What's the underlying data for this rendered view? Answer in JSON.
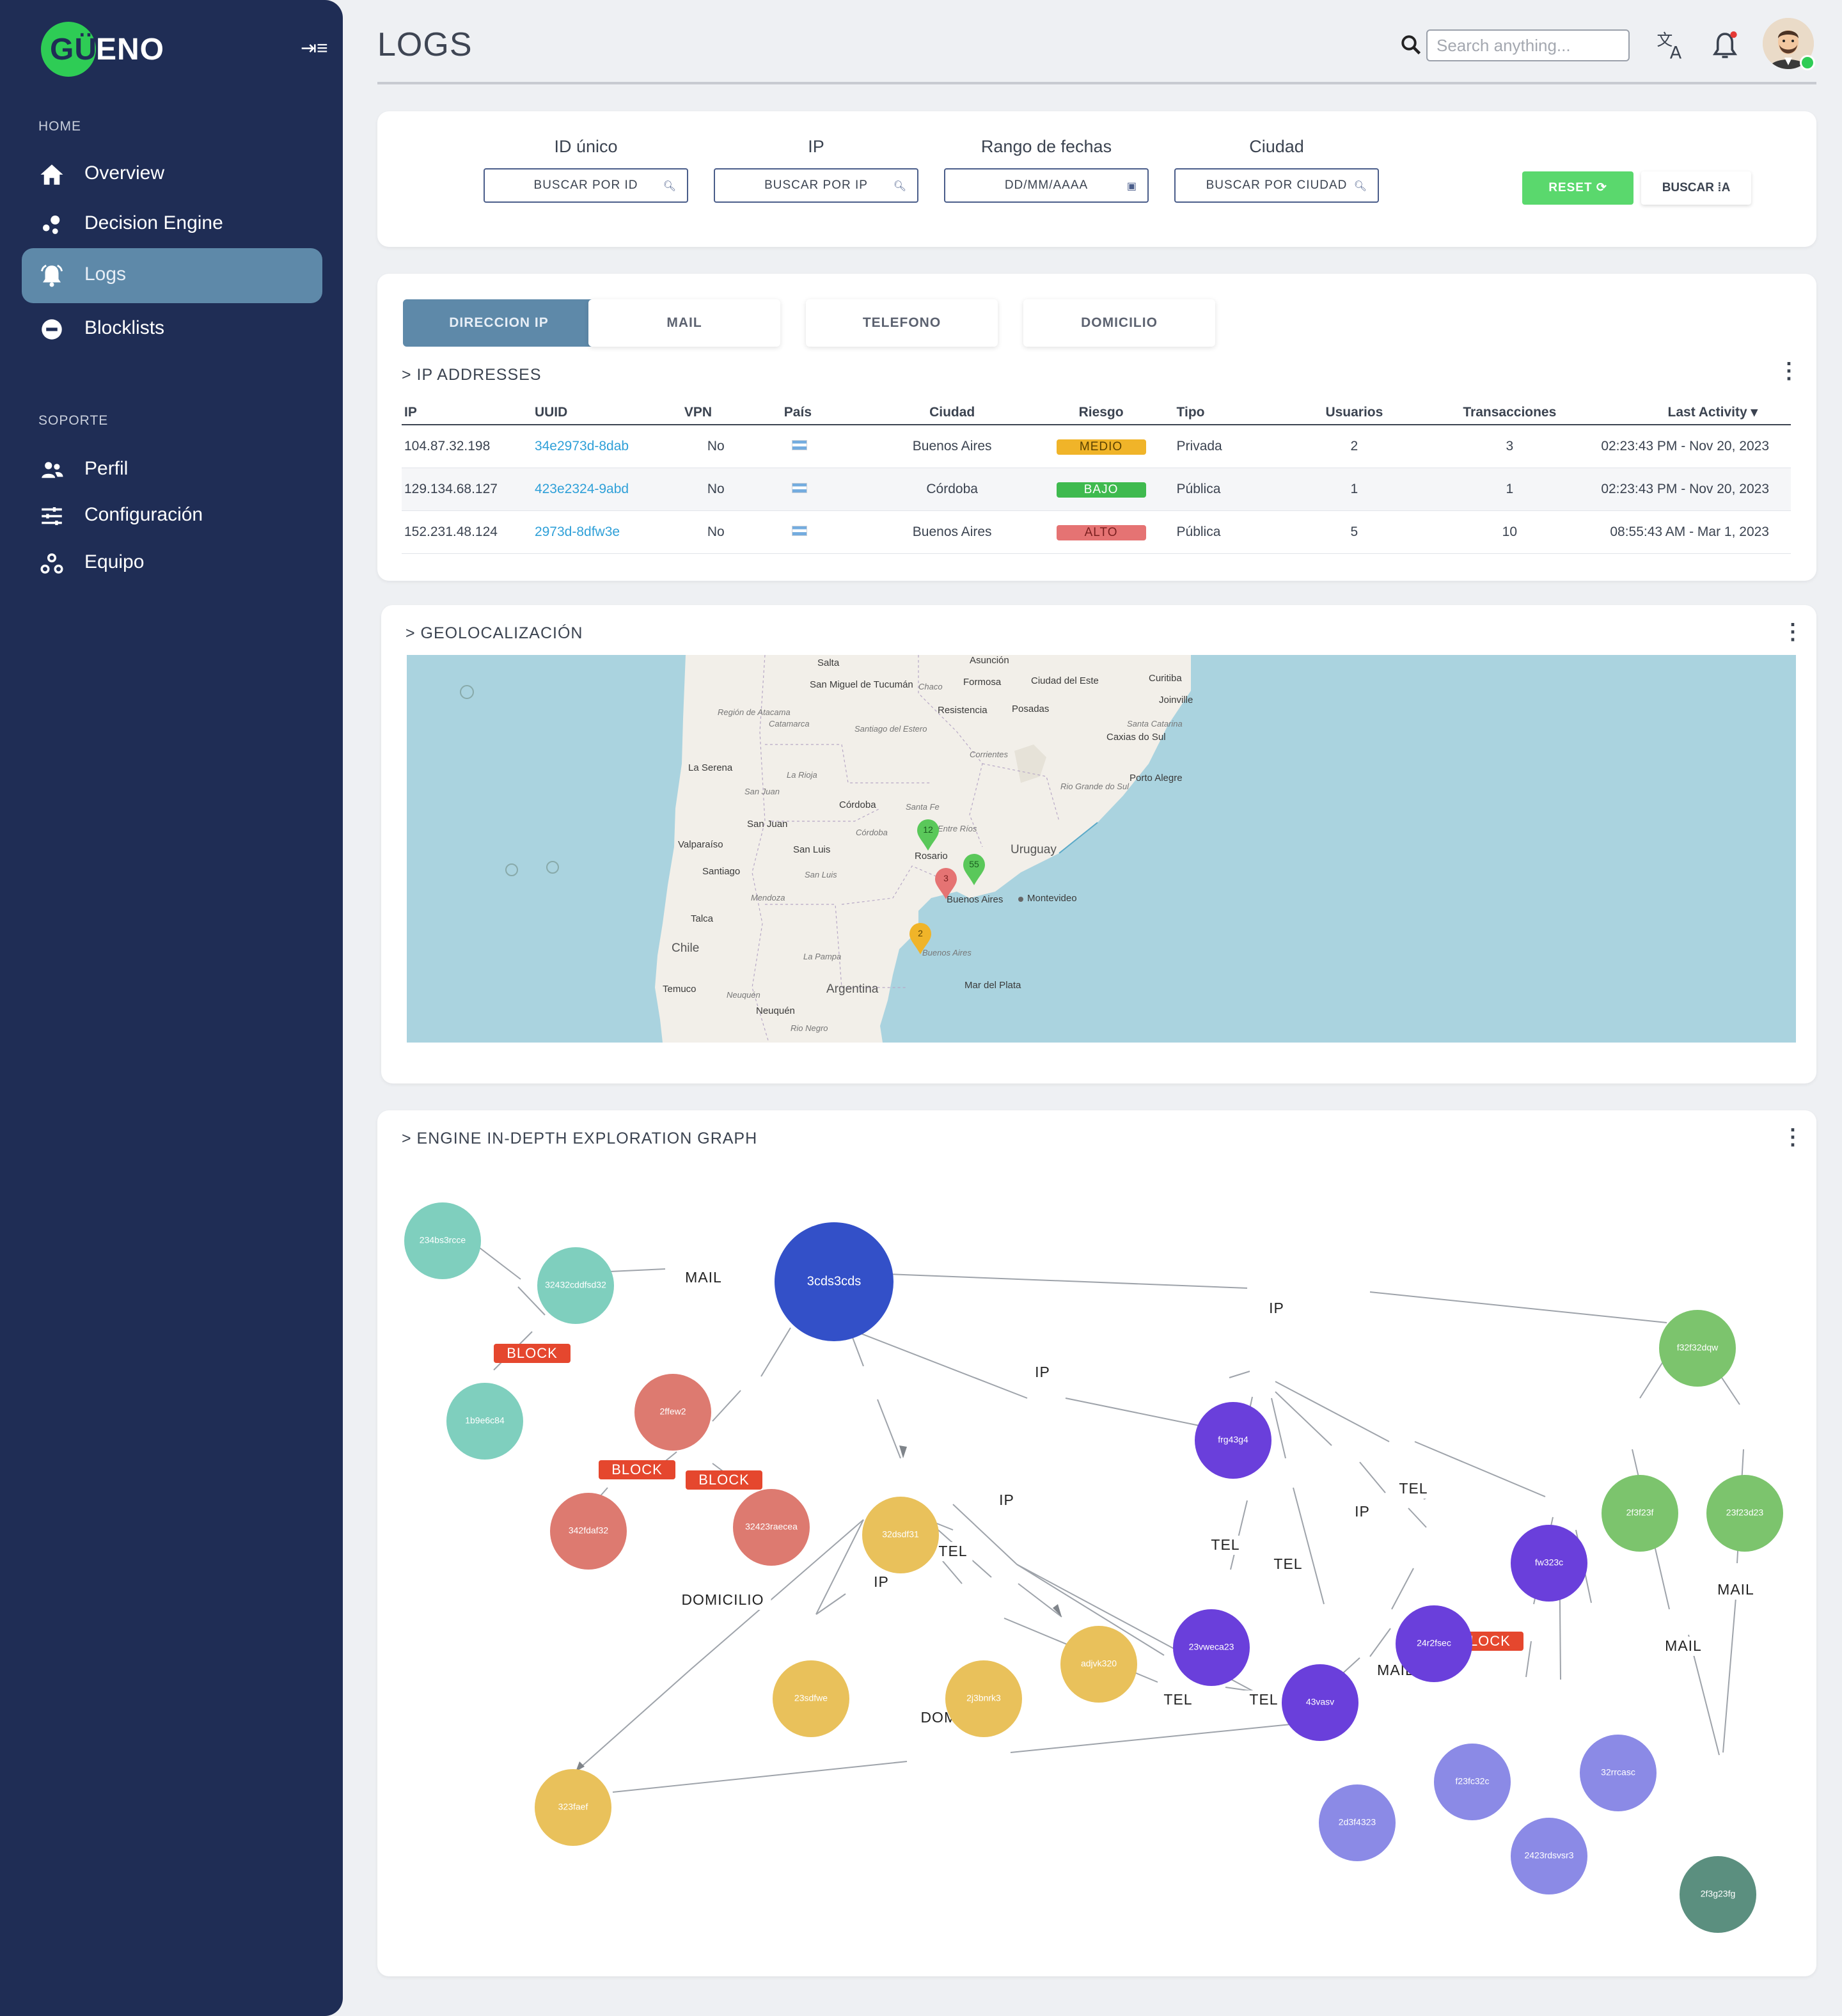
{
  "brand": {
    "logo_left": "GÜ",
    "logo_right": "ENO"
  },
  "sidebar": {
    "section_home": "HOME",
    "section_soporte": "SOPORTE",
    "items": [
      {
        "label": "Overview",
        "icon": "home-icon"
      },
      {
        "label": "Decision Engine",
        "icon": "decision-engine-icon"
      },
      {
        "label": "Logs",
        "icon": "bell-icon",
        "active": true
      },
      {
        "label": "Blocklists",
        "icon": "minus-circle-icon"
      },
      {
        "label": "Perfil",
        "icon": "users-icon"
      },
      {
        "label": "Configuración",
        "icon": "sliders-icon"
      },
      {
        "label": "Equipo",
        "icon": "team-icon"
      }
    ]
  },
  "header": {
    "title": "LOGS",
    "search_placeholder": "Search anything..."
  },
  "filters": {
    "id_label": "ID único",
    "id_placeholder": "BUSCAR POR ID",
    "ip_label": "IP",
    "ip_placeholder": "BUSCAR POR IP",
    "fecha_label": "Rango de fechas",
    "fecha_placeholder": "DD/MM/AAAA",
    "ciudad_label": "Ciudad",
    "ciudad_placeholder": "BUSCAR POR CIUDAD",
    "reset": "RESET ⟳",
    "buscar": "BUSCAR ⁞A"
  },
  "tabs": [
    {
      "label": "DIRECCION IP",
      "active": true
    },
    {
      "label": "MAIL"
    },
    {
      "label": "TELEFONO"
    },
    {
      "label": "DOMICILIO"
    }
  ],
  "ip_section": {
    "title": "> IP ADDRESSES",
    "columns": [
      "IP",
      "UUID",
      "VPN",
      "País",
      "Ciudad",
      "Riesgo",
      "Tipo",
      "Usuarios",
      "Transacciones",
      "Last Activity ▾"
    ],
    "rows": [
      {
        "ip": "104.87.32.198",
        "uuid": "34e2973d-8dab",
        "vpn": "No",
        "pais": "Argentina",
        "ciudad": "Buenos Aires",
        "riesgo": "MEDIO",
        "riesgo_color": "#f0b429",
        "tipo": "Privada",
        "usuarios": "2",
        "transacciones": "3",
        "last": "02:23:43 PM - Nov 20, 2023"
      },
      {
        "ip": "129.134.68.127",
        "uuid": "423e2324-9abd",
        "vpn": "No",
        "pais": "Argentina",
        "ciudad": "Córdoba",
        "riesgo": "BAJO",
        "riesgo_color": "#3fba4f",
        "tipo": "Pública",
        "usuarios": "1",
        "transacciones": "1",
        "last": "02:23:43 PM - Nov 20, 2023"
      },
      {
        "ip": "152.231.48.124",
        "uuid": "2973d-8dfw3e",
        "vpn": "No",
        "pais": "Argentina",
        "ciudad": "Buenos Aires",
        "riesgo": "ALTO",
        "riesgo_color": "#e57373",
        "tipo": "Pública",
        "usuarios": "5",
        "transacciones": "10",
        "last": "08:55:43 AM - Mar 1, 2023"
      }
    ]
  },
  "geo": {
    "title": "> GEOLOCALIZACIÓN",
    "places": [
      "Salta",
      "San Miguel de Tucumán",
      "Asunción",
      "Formosa",
      "Ciudad del Este",
      "Curitiba",
      "Joinville",
      "Chaco",
      "Resistencia",
      "Posadas",
      "Región de Atacama",
      "Catamarca",
      "Santiago del Estero",
      "Santa Catarina",
      "Caxias do Sul",
      "La Serena",
      "La Rioja",
      "Corrientes",
      "Porto Alegre",
      "San Juan",
      "Rio Grande do Sul",
      "Córdoba",
      "Santa Fe",
      "San Juan",
      "Entre Ríos",
      "Córdoba",
      "Valparaíso",
      "San Luis",
      "Rosario",
      "Uruguay",
      "Santiago",
      "San Luis",
      "Mendoza",
      "Buenos Aires",
      "Montevideo",
      "Talca",
      "Chile",
      "La Pampa",
      "Buenos Aires",
      "Temuco",
      "Argentina",
      "Mar del Plata",
      "Neuquén",
      "Neuquén",
      "Rio Negro"
    ],
    "markers": [
      {
        "count": "12",
        "color": "#5ac85a"
      },
      {
        "count": "55",
        "color": "#5ac85a"
      },
      {
        "count": "3",
        "color": "#e57373"
      },
      {
        "count": "2",
        "color": "#f0b429"
      }
    ]
  },
  "graph": {
    "title": "> ENGINE IN-DEPTH EXPLORATION GRAPH",
    "nodes": [
      "234bs3rcce",
      "32432cddfsd32",
      "3cds3cds",
      "1b9e6c84",
      "2ffew2",
      "342fdaf32",
      "32423raecea",
      "32dsdf31",
      "adjvk320",
      "23sdfwe",
      "2j3bnrk3",
      "323faef",
      "frg43g4",
      "23vweca23",
      "43vasv",
      "24r2fsec",
      "fw323c",
      "f23fc32c",
      "2423rdsvsr3",
      "32rrcasc",
      "2d3f4323",
      "f32f32dqw",
      "2f3f23f",
      "23f23d23",
      "2f3g23fg"
    ],
    "edge_labels": [
      "MAIL",
      "IP",
      "IP",
      "BLOCK",
      "BLOCK",
      "BLOCK",
      "IP",
      "TEL",
      "IP",
      "DOMICILIO",
      "TEL",
      "TEL",
      "IP",
      "TEL",
      "MAIL",
      "BLOCK",
      "TEL",
      "TEL",
      "DOMICILIO",
      "MAIL",
      "MAIL"
    ]
  }
}
